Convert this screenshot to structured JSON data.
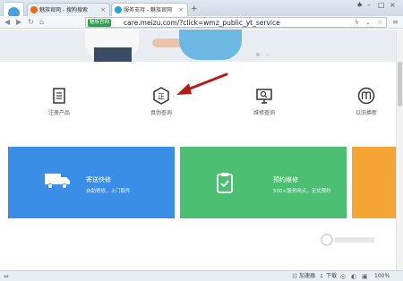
{
  "browser": {
    "tabs": [
      {
        "label": "魅族官网 - 搜狗搜索"
      },
      {
        "label": "服务支持 - 魅族官网"
      }
    ],
    "new_tab": "+",
    "address": {
      "badge": "魅族官网",
      "url": "care.meizu.com/?click=wmz_public_yt_service"
    },
    "status": {
      "accelerator": "加速器",
      "download": "下载",
      "zoom": "100%"
    }
  },
  "services": [
    {
      "label": "注册产品",
      "icon": "document-icon"
    },
    {
      "label": "真伪查询",
      "icon": "hexagon-authentic-icon"
    },
    {
      "label": "维修查询",
      "icon": "monitor-search-icon"
    },
    {
      "label": "以旧换新",
      "icon": "meizu-m-icon"
    }
  ],
  "cards": [
    {
      "title": "寄送快修",
      "subtitle": "自助寄修，上门取件",
      "color": "#3a8ee6",
      "icon": "truck-icon"
    },
    {
      "title": "预约维修",
      "subtitle": "500+服务网点，无忧预约",
      "color": "#4cbf73",
      "icon": "clipboard-icon"
    }
  ],
  "colors": {
    "accent_blue": "#3a8ee6",
    "accent_green": "#4cbf73",
    "accent_orange": "#f4a534",
    "annotation_arrow": "#b71c1c"
  }
}
